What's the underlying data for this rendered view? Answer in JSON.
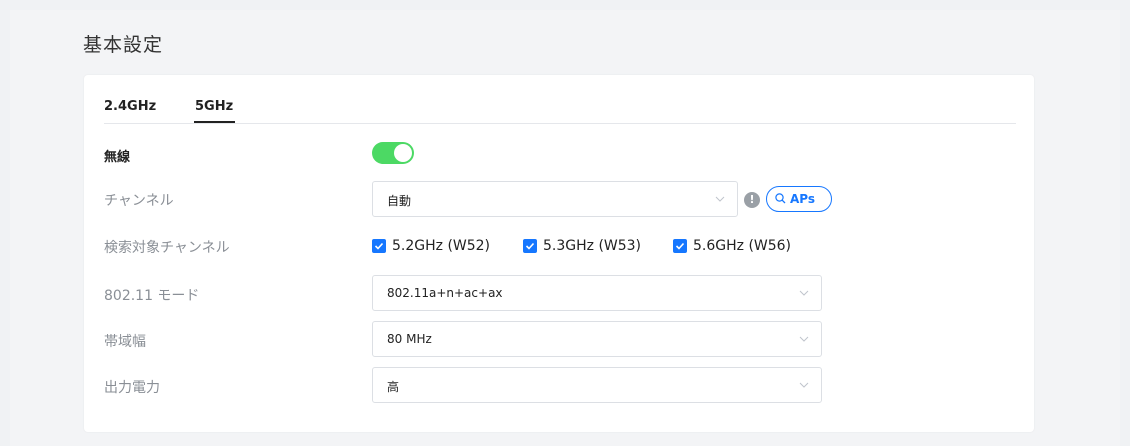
{
  "page": {
    "title": "基本設定"
  },
  "tabs": [
    {
      "label": "2.4GHz",
      "active": false
    },
    {
      "label": "5GHz",
      "active": true
    }
  ],
  "wireless": {
    "label": "無線",
    "enabled": true
  },
  "channel": {
    "label": "チャンネル",
    "value": "自動",
    "info_icon": "exclamation-icon",
    "aps_button": "APs"
  },
  "search_channels": {
    "label": "検索対象チャンネル",
    "options": [
      {
        "label": "5.2GHz (W52)",
        "checked": true
      },
      {
        "label": "5.3GHz (W53)",
        "checked": true
      },
      {
        "label": "5.6GHz (W56)",
        "checked": true
      }
    ]
  },
  "mode": {
    "label": "802.11 モード",
    "value": "802.11a+n+ac+ax"
  },
  "bandwidth": {
    "label": "帯域幅",
    "value": "80 MHz"
  },
  "tx_power": {
    "label": "出力電力",
    "value": "高"
  },
  "colors": {
    "accent": "#1677ff",
    "toggle_on": "#4cd964"
  }
}
